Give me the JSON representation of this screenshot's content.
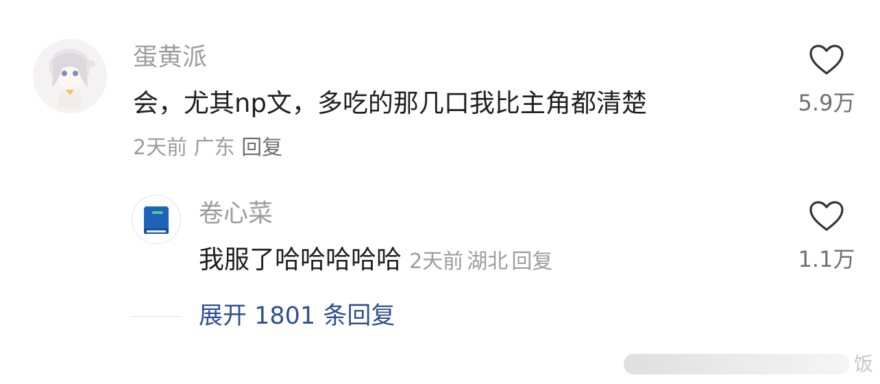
{
  "comment": {
    "username": "蛋黄派",
    "text": "会，尤其np文，多吃的那几口我比主角都清楚",
    "time": "2天前",
    "location": "广东",
    "reply_label": "回复",
    "like_count": "5.9万"
  },
  "sub_reply": {
    "username": "卷心菜",
    "text": "我服了哈哈哈哈哈",
    "time": "2天前",
    "location": "湖北",
    "reply_label": "回复",
    "like_count": "1.1万"
  },
  "expand": {
    "label": "展开 1801 条回复"
  },
  "watermark": {
    "text": "饭"
  },
  "icons": {
    "like": "heart-outline-icon",
    "book": "book-icon"
  },
  "colors": {
    "username": "#9c9c9c",
    "text": "#1f1f1f",
    "meta": "#9c9c9c",
    "expand_link": "#2e4f8f",
    "book_icon": "#1e63b8"
  }
}
